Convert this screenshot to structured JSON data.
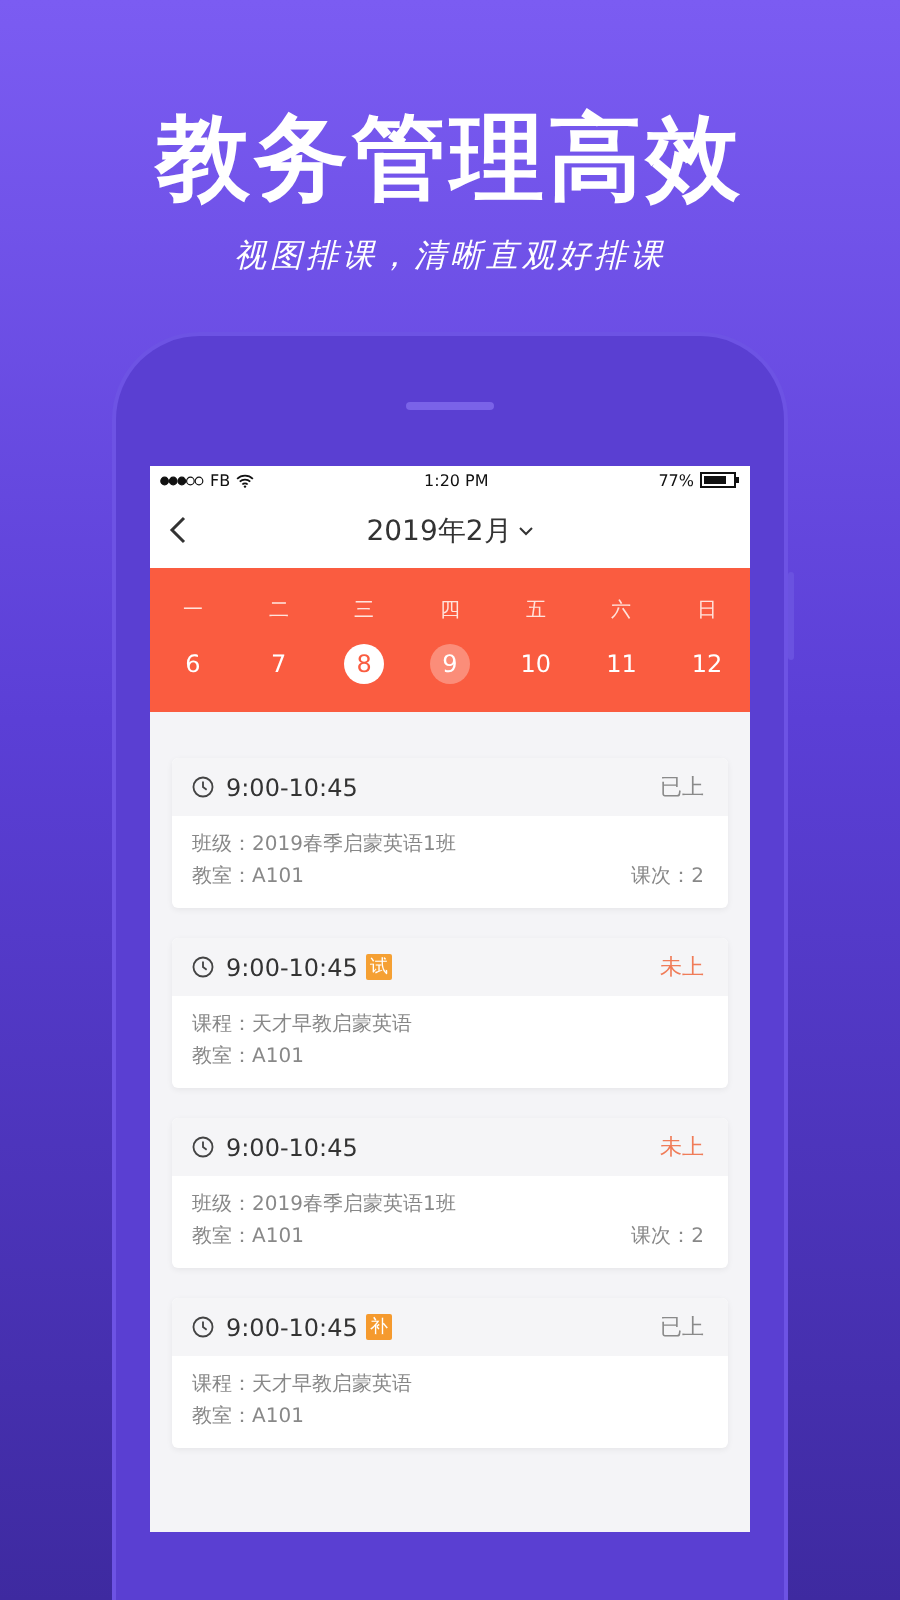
{
  "headline": "教务管理高效",
  "subtitle": "视图排课，清晰直观好排课",
  "status_bar": {
    "carrier": "FB",
    "time": "1:20 PM",
    "battery": "77%"
  },
  "nav": {
    "title": "2019年2月"
  },
  "week": [
    {
      "weekday": "一",
      "date": "6",
      "selected": false,
      "marked": false
    },
    {
      "weekday": "二",
      "date": "7",
      "selected": false,
      "marked": false
    },
    {
      "weekday": "三",
      "date": "8",
      "selected": true,
      "marked": false
    },
    {
      "weekday": "四",
      "date": "9",
      "selected": false,
      "marked": true
    },
    {
      "weekday": "五",
      "date": "10",
      "selected": false,
      "marked": false
    },
    {
      "weekday": "六",
      "date": "11",
      "selected": false,
      "marked": false
    },
    {
      "weekday": "日",
      "date": "12",
      "selected": false,
      "marked": false
    }
  ],
  "lessons": [
    {
      "time": "9:00-10:45",
      "status": {
        "text": "已上",
        "color": "#8a8a8a"
      },
      "lines": [
        {
          "text": "班级：2019春季启蒙英语1班"
        },
        {
          "text": "教室：A101",
          "extra": "课次：2"
        }
      ]
    },
    {
      "time": "9:00-10:45",
      "tag": {
        "text": "试",
        "color": "#f5a033"
      },
      "status": {
        "text": "未上",
        "color": "#f07c58"
      },
      "lines": [
        {
          "text": "课程：天才早教启蒙英语"
        },
        {
          "text": "教室：A101"
        }
      ]
    },
    {
      "time": "9:00-10:45",
      "status": {
        "text": "未上",
        "color": "#f07c58"
      },
      "lines": [
        {
          "text": "班级：2019春季启蒙英语1班"
        },
        {
          "text": "教室：A101",
          "extra": "课次：2"
        }
      ]
    },
    {
      "time": "9:00-10:45",
      "tag": {
        "text": "补",
        "color": "#f59a2e"
      },
      "status": {
        "text": "已上",
        "color": "#8a8a8a"
      },
      "lines": [
        {
          "text": "课程：天才早教启蒙英语"
        },
        {
          "text": "教室：A101"
        }
      ]
    }
  ]
}
